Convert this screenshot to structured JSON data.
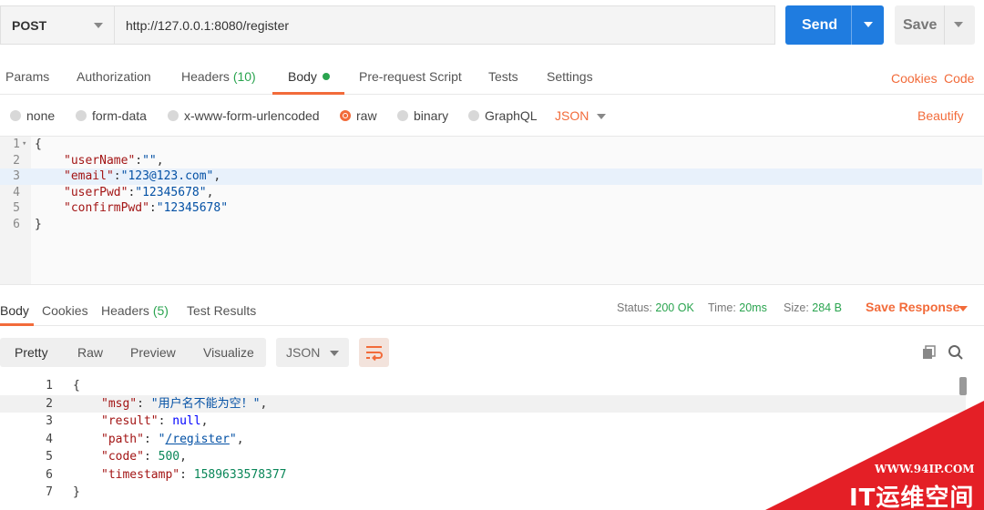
{
  "request": {
    "method": "POST",
    "url": "http://127.0.0.1:8080/register",
    "send_label": "Send",
    "save_label": "Save"
  },
  "request_tabs": {
    "params": "Params",
    "authorization": "Authorization",
    "headers": "Headers",
    "headers_count": "(10)",
    "body": "Body",
    "prerequest": "Pre-request Script",
    "tests": "Tests",
    "settings": "Settings",
    "cookies": "Cookies",
    "code": "Code"
  },
  "body_types": {
    "none": "none",
    "form_data": "form-data",
    "urlencoded": "x-www-form-urlencoded",
    "raw": "raw",
    "binary": "binary",
    "graphql": "GraphQL",
    "format": "JSON",
    "beautify": "Beautify"
  },
  "request_body": {
    "line_numbers": [
      "1",
      "2",
      "3",
      "4",
      "5",
      "6"
    ],
    "open": "{",
    "close": "}",
    "fields": [
      {
        "key": "\"userName\"",
        "value": "\"\"",
        "tail": ","
      },
      {
        "key": "\"email\"",
        "value": "\"123@123.com\"",
        "tail": ","
      },
      {
        "key": "\"userPwd\"",
        "value": "\"12345678\"",
        "tail": ","
      },
      {
        "key": "\"confirmPwd\"",
        "value": "\"12345678\"",
        "tail": ""
      }
    ]
  },
  "response_tabs": {
    "body": "Body",
    "cookies": "Cookies",
    "headers": "Headers",
    "headers_count": "(5)",
    "test_results": "Test Results"
  },
  "response_status": {
    "status_label": "Status:",
    "status_value": "200 OK",
    "time_label": "Time:",
    "time_value": "20ms",
    "size_label": "Size:",
    "size_value": "284 B",
    "save_response": "Save Response"
  },
  "response_view": {
    "pretty": "Pretty",
    "raw": "Raw",
    "preview": "Preview",
    "visualize": "Visualize",
    "format": "JSON"
  },
  "response_body": {
    "line_numbers": [
      "1",
      "2",
      "3",
      "4",
      "5",
      "6",
      "7"
    ],
    "open": "{",
    "close": "}",
    "msg_key": "\"msg\"",
    "msg_value": "\"用户名不能为空！\"",
    "result_key": "\"result\"",
    "result_value": "null",
    "path_key": "\"path\"",
    "path_value": "/register",
    "code_key": "\"code\"",
    "code_value": "500",
    "timestamp_key": "\"timestamp\"",
    "timestamp_value": "1589633578377"
  },
  "watermark": {
    "url": "WWW.94IP.COM",
    "name": "IT运维空间"
  },
  "colors": {
    "accent": "#f26b3a",
    "send": "#1f7ce0",
    "success": "#2aa44f"
  }
}
